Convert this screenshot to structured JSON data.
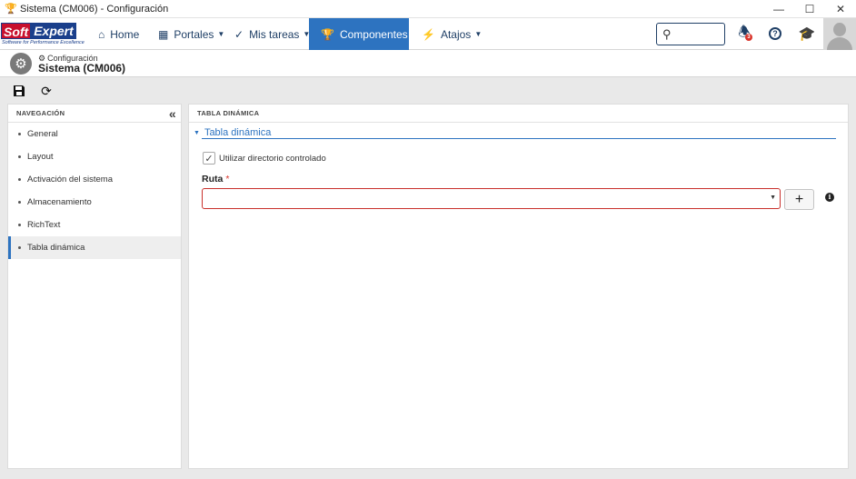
{
  "window": {
    "title": "Sistema (CM006) - Configuración",
    "app_icon": "trophy-icon",
    "controls": [
      "minimize-icon",
      "maximize-icon",
      "close-icon"
    ]
  },
  "logo": {
    "soft": "Soft",
    "expert": "Expert",
    "registered": "®",
    "tagline": "Software for Performance Excellence"
  },
  "nav": {
    "items": [
      {
        "label": "Home",
        "icon": "home-icon",
        "dropdown": false
      },
      {
        "label": "Portales",
        "icon": "grid-icon",
        "dropdown": true
      },
      {
        "label": "Mis tareas",
        "icon": "check-icon",
        "dropdown": true
      },
      {
        "label": "Componentes",
        "icon": "trophy-icon",
        "dropdown": true,
        "active": true
      },
      {
        "label": "Atajos",
        "icon": "bolt-icon",
        "dropdown": true
      }
    ],
    "search_placeholder": "",
    "notification_count": "3",
    "accent_color": "#2d73c0"
  },
  "header": {
    "breadcrumb": "Configuración",
    "title": "Sistema (CM006)"
  },
  "toolbar": {
    "buttons": [
      "save-icon",
      "refresh-icon"
    ]
  },
  "sidebar": {
    "header": "NAVEGACIÓN",
    "items": [
      {
        "label": "General"
      },
      {
        "label": "Layout"
      },
      {
        "label": "Activación del sistema"
      },
      {
        "label": "Almacenamiento"
      },
      {
        "label": "RichText"
      },
      {
        "label": "Tabla dinámica",
        "selected": true
      }
    ]
  },
  "main": {
    "header": "TABLA DINÁMICA",
    "section": "Tabla dinámica",
    "checkbox_label": "Utilizar directorio controlado",
    "checkbox_checked": true,
    "field_label": "Ruta",
    "required_mark": "*",
    "field_value": "",
    "add_label": "+"
  }
}
